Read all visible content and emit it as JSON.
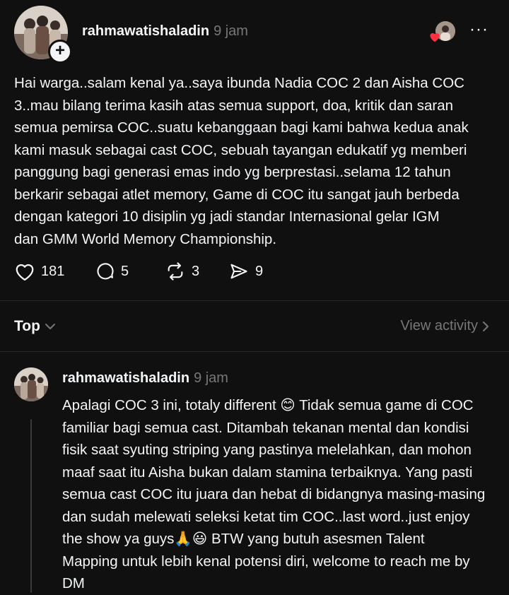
{
  "post": {
    "username": "rahmawatishaladin",
    "time": "9 jam",
    "follow_symbol": "+",
    "more_symbol": "···",
    "text": "Hai warga..salam kenal ya..saya ibunda Nadia COC 2 dan Aisha COC\n3..mau bilang terima kasih atas semua support, doa, kritik dan saran\nsemua pemirsa COC..suatu kebanggaan bagi kami bahwa kedua anak\nkami masuk sebagai cast COC, sebuah tayangan edukatif yg memberi\npanggung bagi generasi emas indo yg berprestasi..selama 12 tahun\nberkarir sebagai atlet memory, Game di COC itu sangat jauh berbeda\ndengan kategori 10 disiplin yg jadi standar Internasional gelar IGM\ndan GMM World Memory Championship.",
    "likes": "181",
    "comments": "5",
    "reposts": "3",
    "shares": "9"
  },
  "sort": {
    "label": "Top",
    "view_activity": "View activity"
  },
  "reply": {
    "username": "rahmawatishaladin",
    "time": "9 jam",
    "text": "Apalagi COC 3 ini, totaly different 😊 Tidak semua game di COC\nfamiliar bagi semua cast. Ditambah tekanan mental dan kondisi\nfisik saat syuting striping yang pastinya melelahkan, dan mohon\nmaaf saat itu Aisha bukan dalam stamina terbaiknya. Yang pasti\nsemua cast COC itu juara dan hebat di bidangnya masing-masing\ndan sudah melewati seleksi ketat tim COC..last word..just enjoy\nthe show ya guys🙏😃 BTW yang butuh asesmen Talent\nMapping untuk lebih kenal potensi diri, welcome to reach me by\nDM"
  },
  "icons": {
    "like": "heart-icon",
    "comment": "comment-bubble-icon",
    "repost": "repost-icon",
    "share": "send-icon",
    "sort_chevron": "chevron-down-icon",
    "activity_chevron": "chevron-right-icon",
    "more": "more-icon",
    "liked_by": "liked-by-avatar"
  },
  "colors": {
    "background": "#101010",
    "text": "#f3f5f7",
    "muted": "#777777",
    "like_badge": "#ff3040"
  }
}
